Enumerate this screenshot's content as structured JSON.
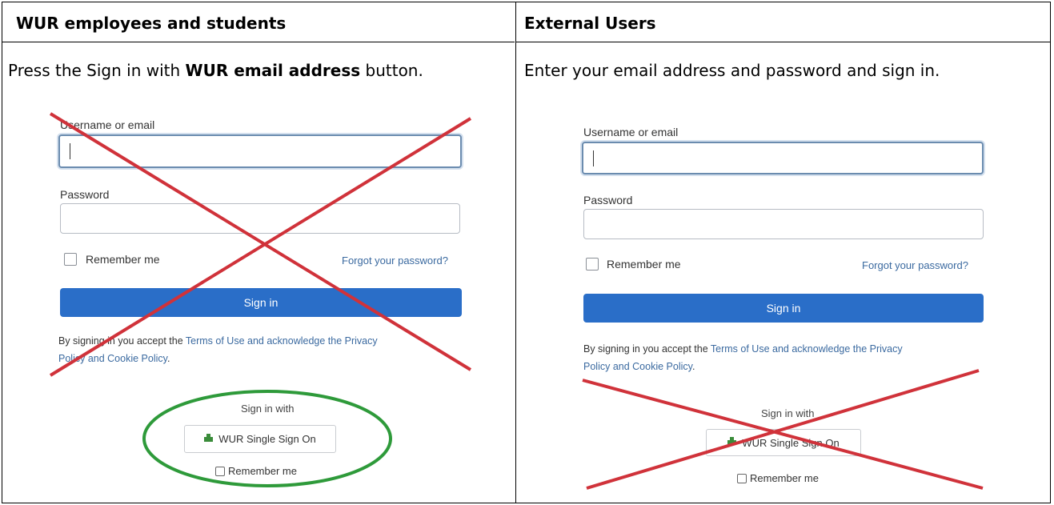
{
  "left": {
    "heading": "WUR employees and students",
    "instruction_pre": "Press the Sign in with ",
    "instruction_bold": "WUR email address",
    "instruction_post": " button.",
    "screenshot": {
      "username_label": "Username or email",
      "password_label": "Password",
      "remember_label": "Remember me",
      "forgot_link": "Forgot your password?",
      "signin_button": "Sign in",
      "terms_pre": "By signing in you accept the ",
      "terms_link1": "Terms of Use and acknowledge the Privacy",
      "terms_link2": "Policy and Cookie Policy",
      "terms_post": ".",
      "sso_caption": "Sign in with",
      "sso_button": "WUR Single Sign On",
      "sso_remember": "Remember me",
      "highlight_color": "#2e9a3a"
    }
  },
  "right": {
    "heading": "External Users",
    "instruction": "Enter your email address and password and sign in.",
    "screenshot": {
      "username_label": "Username or email",
      "password_label": "Password",
      "remember_label": "Remember me",
      "forgot_link": "Forgot your password?",
      "signin_button": "Sign in",
      "terms_pre": "By signing in you accept the ",
      "terms_link1": "Terms of Use and acknowledge the Privacy",
      "terms_link2": "Policy and Cookie Policy",
      "terms_post": ".",
      "sso_caption": "Sign in with",
      "sso_button": "WUR Single Sign On",
      "sso_remember": "Remember me"
    }
  },
  "colors": {
    "cross": "#d0323a",
    "link": "#3b6aa0",
    "button": "#2a6ec8"
  }
}
